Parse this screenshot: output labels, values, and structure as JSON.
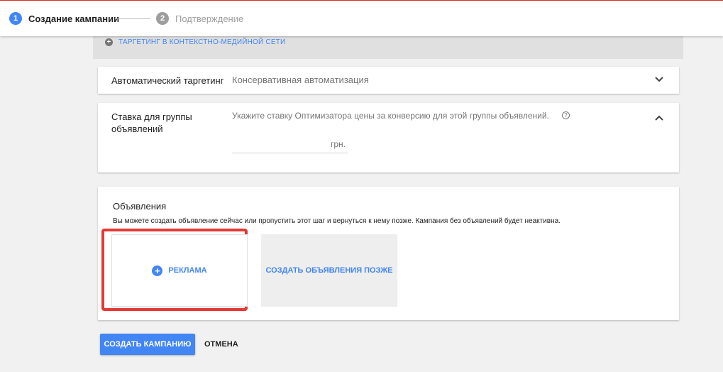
{
  "header": {
    "steps": [
      {
        "number": "1",
        "label": "Создание кампании"
      },
      {
        "number": "2",
        "label": "Подтверждение"
      }
    ]
  },
  "targeting": {
    "link_label": "ТАРГЕТИНГ В КОНТЕКСТНО-МЕДИЙНОЙ СЕТИ"
  },
  "auto_targeting": {
    "label": "Автоматический таргетинг",
    "value": "Консервативная автоматизация"
  },
  "bid": {
    "label_line1": "Ставка для группы",
    "label_line2": "объявлений",
    "hint": "Укажите ставку Оптимизатора цены за конверсию для этой группы объявлений.",
    "unit": "грн.",
    "value": ""
  },
  "ads": {
    "title": "Объявления",
    "description": "Вы можете создать объявление сейчас или пропустить этот шаг и вернуться к нему позже. Кампания без объявлений будет неактивна.",
    "new_ad_label": "РЕКЛАМА",
    "later_label": "СОЗДАТЬ ОБЪЯВЛЕНИЯ ПОЗЖЕ"
  },
  "actions": {
    "create_label": "СОЗДАТЬ КАМПАНИЮ",
    "cancel_label": "ОТМЕНА"
  },
  "colors": {
    "accent": "#4285f4",
    "highlight_frame": "#e53935",
    "inactive_step": "#9e9e9e"
  },
  "icons": [
    "plus-circle-icon",
    "chevron-down-icon",
    "chevron-up-icon",
    "help-circle-icon"
  ]
}
